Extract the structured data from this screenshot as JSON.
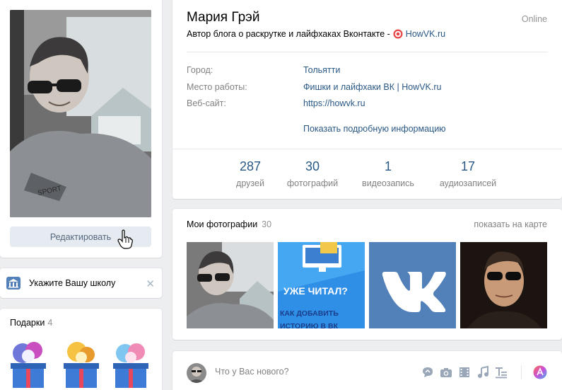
{
  "profile": {
    "name": "Мария Грэй",
    "online": "Online",
    "status_text": "Автор блога о раскрутке и лайфхаках Вконтакте -",
    "status_link": "HowVK.ru",
    "edit_button": "Редактировать"
  },
  "info": {
    "rows": [
      {
        "label": "Город:",
        "value": "Тольятти"
      },
      {
        "label": "Место работы:",
        "value": "Фишки и лайфхаки ВК | HowVK.ru"
      },
      {
        "label": "Веб-сайт:",
        "value": "https://howvk.ru"
      }
    ],
    "show_more": "Показать подробную информацию"
  },
  "counters": [
    {
      "value": "287",
      "label": "друзей"
    },
    {
      "value": "30",
      "label": "фотографий"
    },
    {
      "value": "1",
      "label": "видеозапись"
    },
    {
      "value": "17",
      "label": "аудиозаписей"
    }
  ],
  "school": {
    "text": "Укажите Вашу школу",
    "close": "✕"
  },
  "gifts": {
    "title": "Подарки",
    "count": "4"
  },
  "photos": {
    "title": "Мои фотографии",
    "count": "30",
    "map_link": "показать на карте",
    "thumb2": {
      "line1": "УЖЕ ЧИТАЛ?",
      "line2": "КАК ДОБАВИТЬ",
      "line3": "ИСТОРИЮ В ВК"
    }
  },
  "post": {
    "placeholder": "Что у Вас нового?"
  },
  "colors": {
    "accent": "#2a5885",
    "button_bg": "#e5ebf1",
    "vk_blue": "#5181b8"
  }
}
